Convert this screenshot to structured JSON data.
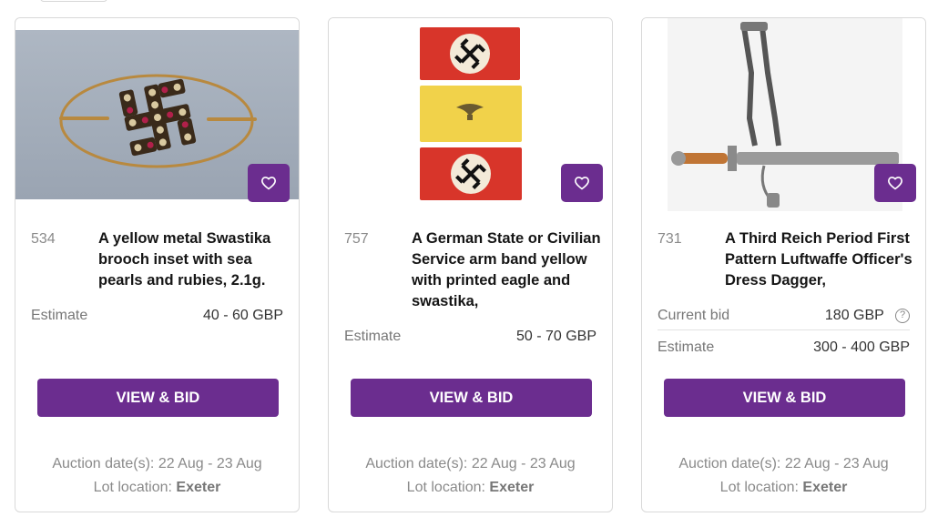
{
  "accent_color": "#6b2d8f",
  "cards": [
    {
      "lot_number": "534",
      "title": "A yellow metal Swastika brooch inset with sea pearls and rubies, 2.1g.",
      "estimate_label": "Estimate",
      "estimate_value": "40 - 60 GBP",
      "button_label": "VIEW & BID",
      "auction_dates": "Auction date(s): 22 Aug - 23 Aug",
      "location_label": "Lot location:",
      "location_value": "Exeter",
      "favorite_icon": "heart-icon"
    },
    {
      "lot_number": "757",
      "title": "A German State or Civilian Service arm band yellow with printed eagle and swastika,",
      "estimate_label": "Estimate",
      "estimate_value": "50 - 70 GBP",
      "button_label": "VIEW & BID",
      "auction_dates": "Auction date(s): 22 Aug - 23 Aug",
      "location_label": "Lot location:",
      "location_value": "Exeter",
      "favorite_icon": "heart-icon"
    },
    {
      "lot_number": "731",
      "title": "A Third Reich Period First Pattern Luftwaffe Officer's Dress Dagger,",
      "current_bid_label": "Current bid",
      "current_bid_value": "180 GBP",
      "help_icon": "question-circle-icon",
      "estimate_label": "Estimate",
      "estimate_value": "300 - 400 GBP",
      "button_label": "VIEW & BID",
      "auction_dates": "Auction date(s): 22 Aug - 23 Aug",
      "location_label": "Lot location:",
      "location_value": "Exeter",
      "favorite_icon": "heart-icon"
    }
  ]
}
